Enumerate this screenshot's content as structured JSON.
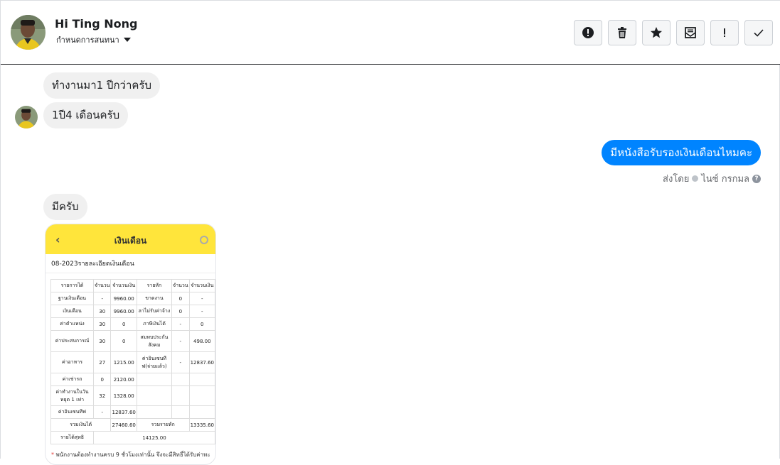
{
  "contact": {
    "name": "Hi Ting Nong",
    "subtitle": "กำหนดการสนทนา"
  },
  "header_actions": [
    {
      "name": "report-button",
      "icon": "alert-circle-icon"
    },
    {
      "name": "delete-button",
      "icon": "trash-icon"
    },
    {
      "name": "star-button",
      "icon": "star-icon"
    },
    {
      "name": "mark-unread-button",
      "icon": "envelope-icon"
    },
    {
      "name": "important-button",
      "icon": "exclamation-icon"
    },
    {
      "name": "done-button",
      "icon": "check-icon"
    }
  ],
  "messages": [
    {
      "from": "contact",
      "text": "ทำงานมา1 ปีกว่าครับ"
    },
    {
      "from": "contact",
      "text": "1ปี4 เดือนครับ"
    },
    {
      "from": "page",
      "text": "มีหนังสือรับรองเงินเดือนไหมคะ"
    },
    {
      "from": "contact",
      "text": "มีครับ"
    }
  ],
  "sent_by": {
    "prefix": "ส่งโดย",
    "name": "ไนซ์ กรกมล"
  },
  "receipt": {
    "title": "เงินเดือน",
    "period": "08-2023รายละเอียดเงินเดือน",
    "headers": [
      "รายการได้",
      "จำนวน",
      "จำนวนเงิน",
      "รายหัก",
      "จำนวน",
      "จำนวนเงิน"
    ],
    "rows": [
      [
        "ฐานเงินเดือน",
        "-",
        "9960.00",
        "ขาดงาน",
        "0",
        "-"
      ],
      [
        "เงินเดือน",
        "30",
        "9960.00",
        "ลาไม่รับค่าจ้าง",
        "0",
        "-"
      ],
      [
        "ค่าตำแหน่ง",
        "30",
        "0",
        "ภาษีเงินได้",
        "-",
        "0"
      ],
      [
        "ค่าประสบการณ์",
        "30",
        "0",
        "สมทบประกันสังคม",
        "-",
        "498.00"
      ],
      [
        "ค่าอาหาร",
        "27",
        "1215.00",
        "ค่าอินเซนทีฟ(จ่ายแล้ว)",
        "-",
        "12837.60"
      ],
      [
        "ค่าเช่ารถ",
        "0",
        "2120.00",
        "",
        "",
        ""
      ],
      [
        "ค่าทำงานในวันหยุด 1 เท่า",
        "32",
        "1328.00",
        "",
        "",
        ""
      ],
      [
        "ค่าอินเซนทีฟ",
        "-",
        "12837.60",
        "",
        "",
        ""
      ]
    ],
    "total_income_label": "รวมเงินได้",
    "total_income": "27460.60",
    "total_deduct_label": "รวมรายหัก",
    "total_deduct": "13335.60",
    "net_label": "รายได้สุทธิ",
    "net": "14125.00",
    "note_star": "*",
    "note": "พนักงานต้องทำงานครบ 9 ชั่วโมงเท่านั้น จึงจะมีสิทธิ์ได้รับค่าทะ"
  },
  "colors": {
    "outgoing_bubble": "#0084ff",
    "incoming_bubble": "#f0f0f0",
    "receipt_header": "#ffe53b"
  }
}
